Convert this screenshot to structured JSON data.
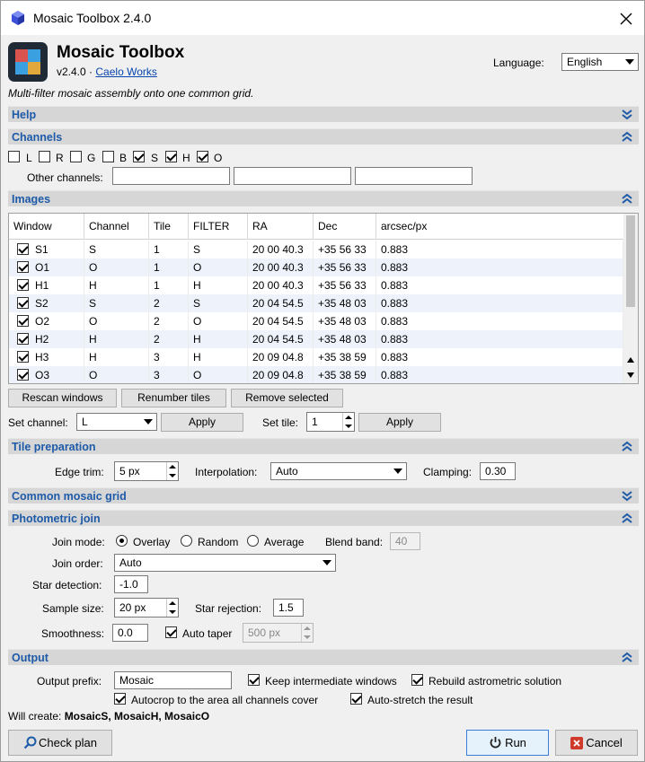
{
  "window": {
    "title": "Mosaic Toolbox 2.4.0"
  },
  "header": {
    "title": "Mosaic Toolbox",
    "version": "v2.4.0",
    "separator": "·",
    "author_link": "Caelo Works",
    "language_label": "Language:",
    "language_value": "English",
    "description": "Multi-filter mosaic assembly onto one common grid."
  },
  "sections": {
    "help": "Help",
    "channels": "Channels",
    "images": "Images",
    "tile_preparation": "Tile preparation",
    "common_grid": "Common mosaic grid",
    "photometric_join": "Photometric join",
    "output": "Output"
  },
  "channels": {
    "items": [
      {
        "label": "L",
        "checked": false
      },
      {
        "label": "R",
        "checked": false
      },
      {
        "label": "G",
        "checked": false
      },
      {
        "label": "B",
        "checked": false
      },
      {
        "label": "S",
        "checked": true
      },
      {
        "label": "H",
        "checked": true
      },
      {
        "label": "O",
        "checked": true
      }
    ],
    "other_label": "Other channels:"
  },
  "images": {
    "columns": [
      "Window",
      "Channel",
      "Tile",
      "FILTER",
      "RA",
      "Dec",
      "arcsec/px"
    ],
    "rows": [
      {
        "window": "S1",
        "channel": "S",
        "tile": "1",
        "filter": "S",
        "ra": "20 00 40.3",
        "dec": "+35 56 33",
        "scale": "0.883"
      },
      {
        "window": "O1",
        "channel": "O",
        "tile": "1",
        "filter": "O",
        "ra": "20 00 40.3",
        "dec": "+35 56 33",
        "scale": "0.883"
      },
      {
        "window": "H1",
        "channel": "H",
        "tile": "1",
        "filter": "H",
        "ra": "20 00 40.3",
        "dec": "+35 56 33",
        "scale": "0.883"
      },
      {
        "window": "S2",
        "channel": "S",
        "tile": "2",
        "filter": "S",
        "ra": "20 04 54.5",
        "dec": "+35 48 03",
        "scale": "0.883"
      },
      {
        "window": "O2",
        "channel": "O",
        "tile": "2",
        "filter": "O",
        "ra": "20 04 54.5",
        "dec": "+35 48 03",
        "scale": "0.883"
      },
      {
        "window": "H2",
        "channel": "H",
        "tile": "2",
        "filter": "H",
        "ra": "20 04 54.5",
        "dec": "+35 48 03",
        "scale": "0.883"
      },
      {
        "window": "H3",
        "channel": "H",
        "tile": "3",
        "filter": "H",
        "ra": "20 09 04.8",
        "dec": "+35 38 59",
        "scale": "0.883"
      },
      {
        "window": "O3",
        "channel": "O",
        "tile": "3",
        "filter": "O",
        "ra": "20 09 04.8",
        "dec": "+35 38 59",
        "scale": "0.883"
      }
    ],
    "rescan": "Rescan windows",
    "renumber": "Renumber tiles",
    "remove": "Remove selected",
    "set_channel_label": "Set channel:",
    "set_channel_value": "L",
    "apply": "Apply",
    "set_tile_label": "Set tile:",
    "set_tile_value": "1"
  },
  "tile_prep": {
    "edge_trim_label": "Edge trim:",
    "edge_trim_value": "5 px",
    "interp_label": "Interpolation:",
    "interp_value": "Auto",
    "clamping_label": "Clamping:",
    "clamping_value": "0.30"
  },
  "photometric": {
    "join_mode_label": "Join mode:",
    "modes": [
      "Overlay",
      "Random",
      "Average"
    ],
    "selected_mode": "Overlay",
    "blend_band_label": "Blend band:",
    "blend_band_value": "40",
    "join_order_label": "Join order:",
    "join_order_value": "Auto",
    "star_detection_label": "Star detection:",
    "star_detection_value": "-1.0",
    "sample_size_label": "Sample size:",
    "sample_size_value": "20 px",
    "star_rejection_label": "Star rejection:",
    "star_rejection_value": "1.5",
    "smoothness_label": "Smoothness:",
    "smoothness_value": "0.0",
    "auto_taper_label": "Auto taper",
    "auto_taper_checked": true,
    "auto_taper_value": "500 px"
  },
  "output": {
    "prefix_label": "Output prefix:",
    "prefix_value": "Mosaic",
    "keep_intermediate": "Keep intermediate windows",
    "rebuild_astrometric": "Rebuild astrometric solution",
    "autocrop": "Autocrop to the area all channels cover",
    "autostretch": "Auto-stretch the result",
    "will_create_label": "Will create:",
    "will_create_value": "MosaicS, MosaicH, MosaicO"
  },
  "footer": {
    "check_plan": "Check plan",
    "run": "Run",
    "cancel": "Cancel"
  },
  "colors": {
    "section_title": "#1d5aa8",
    "accent": "#3a7fd5",
    "cancel_icon": "#d03a2c"
  }
}
